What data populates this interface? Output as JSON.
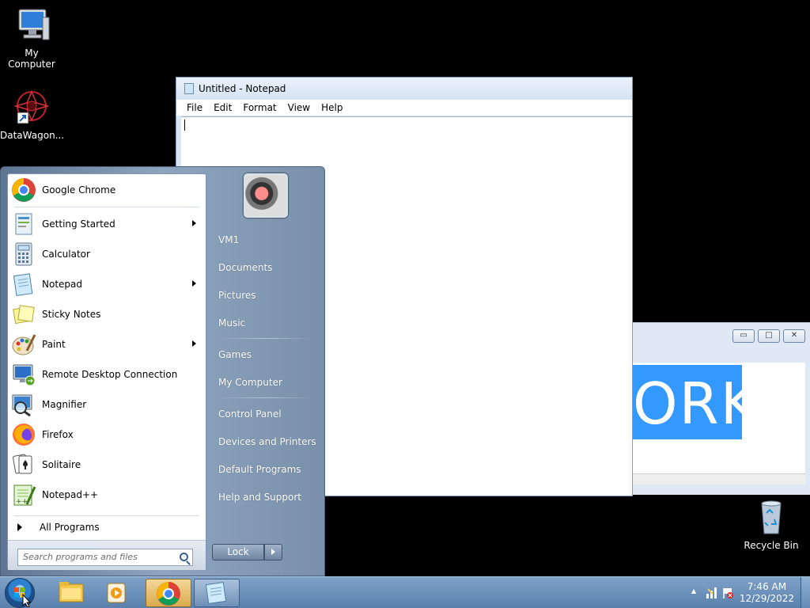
{
  "desktop": {
    "icons": [
      {
        "label": "My Computer"
      },
      {
        "label": "DataWagon..."
      },
      {
        "label": "Recycle Bin"
      }
    ]
  },
  "notepad": {
    "title": "Untitled - Notepad",
    "menu": [
      "File",
      "Edit",
      "Format",
      "View",
      "Help"
    ]
  },
  "background_window": {
    "visible_text": "ORK",
    "controls": {
      "minimize": "▭",
      "maximize": "□",
      "close": "✕"
    }
  },
  "start_menu": {
    "programs": [
      {
        "label": "Google Chrome",
        "icon": "chrome-icon",
        "submenu": false
      },
      {
        "label": "Getting Started",
        "icon": "getting-started-icon",
        "submenu": true
      },
      {
        "label": "Calculator",
        "icon": "calculator-icon",
        "submenu": false
      },
      {
        "label": "Notepad",
        "icon": "notepad-icon",
        "submenu": true
      },
      {
        "label": "Sticky Notes",
        "icon": "sticky-notes-icon",
        "submenu": false
      },
      {
        "label": "Paint",
        "icon": "paint-icon",
        "submenu": true
      },
      {
        "label": "Remote Desktop Connection",
        "icon": "remote-desktop-icon",
        "submenu": false
      },
      {
        "label": "Magnifier",
        "icon": "magnifier-icon",
        "submenu": false
      },
      {
        "label": "Firefox",
        "icon": "firefox-icon",
        "submenu": false
      },
      {
        "label": "Solitaire",
        "icon": "solitaire-icon",
        "submenu": false
      },
      {
        "label": "Notepad++",
        "icon": "notepad-plus-plus-icon",
        "submenu": false
      }
    ],
    "all_programs": "All Programs",
    "search_placeholder": "Search programs and files",
    "right_items": [
      {
        "label": "VM1"
      },
      {
        "label": "Documents"
      },
      {
        "label": "Pictures"
      },
      {
        "label": "Music"
      },
      {
        "label": "Games"
      },
      {
        "label": "My Computer"
      },
      {
        "label": "Control Panel"
      },
      {
        "label": "Devices and Printers"
      },
      {
        "label": "Default Programs"
      },
      {
        "label": "Help and Support"
      }
    ],
    "lock_label": "Lock"
  },
  "taskbar": {
    "time": "7:46 AM",
    "date": "12/29/2022",
    "tray_up_arrow": "▲"
  },
  "colors": {
    "selection_blue": "#3399ff",
    "taskbar": "#6a8fbb"
  }
}
